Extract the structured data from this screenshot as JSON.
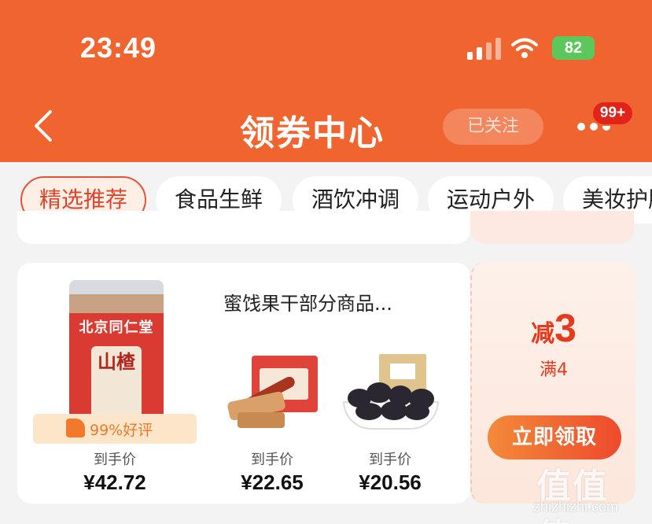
{
  "status_bar": {
    "time": "23:49",
    "battery": "82"
  },
  "header": {
    "title": "领券中心",
    "follow_label": "已关注",
    "badge": "99+"
  },
  "tabs": [
    {
      "label": "精选推荐",
      "active": true
    },
    {
      "label": "食品生鲜",
      "active": false
    },
    {
      "label": "酒饮冲调",
      "active": false
    },
    {
      "label": "运动户外",
      "active": false
    },
    {
      "label": "美妆护肤",
      "active": false
    }
  ],
  "card": {
    "title": "蜜饯果干部分商品...",
    "main_product": {
      "brand": "北京同仁堂",
      "label": "山楂",
      "rating": "99%好评",
      "price_label": "到手价",
      "price": "¥42.72"
    },
    "products": [
      {
        "price_label": "到手价",
        "price": "¥22.65"
      },
      {
        "price_label": "到手价",
        "price": "¥20.56"
      }
    ]
  },
  "coupon": {
    "prefix": "减",
    "amount": "3",
    "condition": "满4",
    "claim_label": "立即领取"
  },
  "watermark": {
    "logo": "值值值",
    "url": "zhizhizhi.com"
  },
  "colors": {
    "brand": "#f0652f",
    "accent": "#e53a1e",
    "rating": "#f07a2a"
  }
}
